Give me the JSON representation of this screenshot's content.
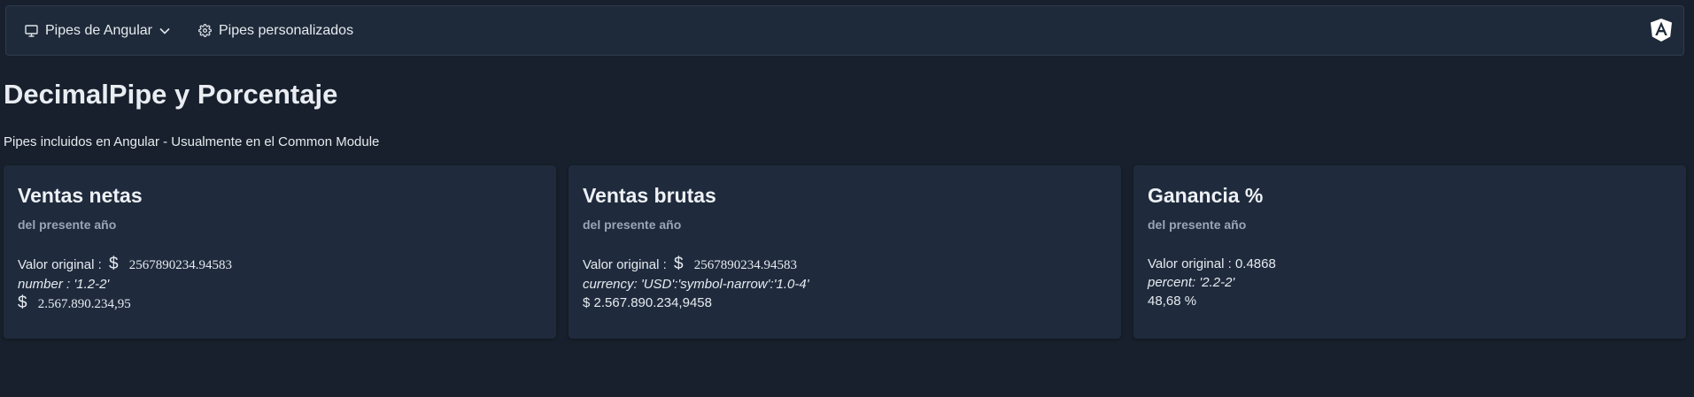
{
  "navbar": {
    "items": [
      {
        "label": "Pipes de Angular",
        "icon": "monitor-icon",
        "has_dropdown": true
      },
      {
        "label": "Pipes personalizados",
        "icon": "gear-icon",
        "has_dropdown": false
      }
    ],
    "logo": "angular-logo"
  },
  "page": {
    "title": "DecimalPipe y Porcentaje",
    "subtitle": "Pipes incluidos en Angular - Usualmente en el Common Module"
  },
  "cards": [
    {
      "title": "Ventas netas",
      "subtitle": "del presente año",
      "original_label": "Valor original :",
      "original_symbol": "$",
      "original_value": "2567890234.94583",
      "pipe": "number : '1.2-2'",
      "result_symbol": "$",
      "result_value": "2.567.890.234,95"
    },
    {
      "title": "Ventas brutas",
      "subtitle": "del presente año",
      "original_label": "Valor original :",
      "original_symbol": "$",
      "original_value": "2567890234.94583",
      "pipe": "currency: 'USD':'symbol-narrow':'1.0-4'",
      "result_value": "$ 2.567.890.234,9458"
    },
    {
      "title": "Ganancia %",
      "subtitle": "del presente año",
      "original_label": "Valor original :",
      "original_value": "0.4868",
      "pipe": "percent: '2.2-2'",
      "result_value": "48,68 %"
    }
  ],
  "colors": {
    "background": "#17202c",
    "surface": "#1f2b3d",
    "navbar": "#1e2a3a",
    "muted_text": "#9aa5b5"
  }
}
